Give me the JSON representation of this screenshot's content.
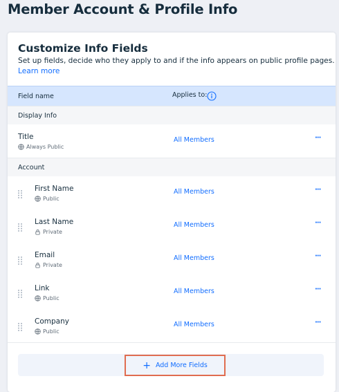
{
  "page": {
    "title": "Member Account & Profile Info"
  },
  "card": {
    "title": "Customize Info Fields",
    "subtitle": "Set up fields, decide who they apply to and if the info appears on public profile pages.",
    "learn_more": "Learn more"
  },
  "table": {
    "col_field": "Field name",
    "col_applies": "Applies to:"
  },
  "sections": [
    {
      "label": "Display Info",
      "rows": [
        {
          "name": "Title",
          "privacy": "Always Public",
          "privacy_icon": "globe-icon",
          "applies": "All Members",
          "draggable": false
        }
      ]
    },
    {
      "label": "Account",
      "rows": [
        {
          "name": "First Name",
          "privacy": "Public",
          "privacy_icon": "globe-icon",
          "applies": "All Members",
          "draggable": true
        },
        {
          "name": "Last Name",
          "privacy": "Private",
          "privacy_icon": "lock-icon",
          "applies": "All Members",
          "draggable": true
        },
        {
          "name": "Email",
          "privacy": "Private",
          "privacy_icon": "lock-icon",
          "applies": "All Members",
          "draggable": true
        },
        {
          "name": "Link",
          "privacy": "Public",
          "privacy_icon": "globe-icon",
          "applies": "All Members",
          "draggable": true
        },
        {
          "name": "Company",
          "privacy": "Public",
          "privacy_icon": "globe-icon",
          "applies": "All Members",
          "draggable": true
        }
      ]
    }
  ],
  "more_label": "···",
  "add_button": {
    "label": "Add More Fields",
    "icon": "plus-icon"
  },
  "colors": {
    "accent": "#116dff",
    "header_bg": "#d6e6fe",
    "highlight": "#e06c4f"
  }
}
